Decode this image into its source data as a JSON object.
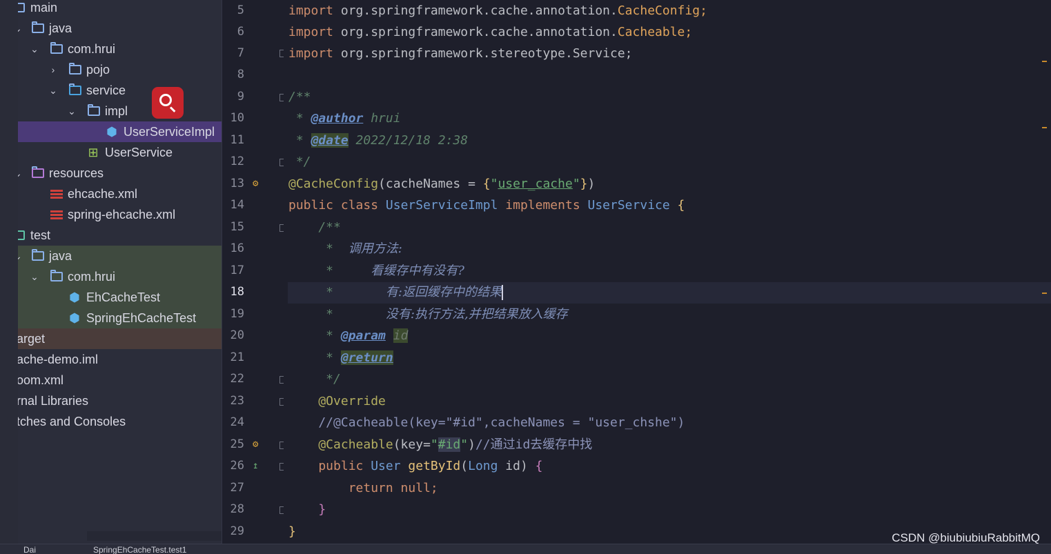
{
  "project_tree": [
    {
      "label": "main",
      "kind": "folder-root"
    },
    {
      "label": "java",
      "kind": "folder"
    },
    {
      "label": "com.hrui",
      "kind": "package"
    },
    {
      "label": "pojo",
      "kind": "package"
    },
    {
      "label": "service",
      "kind": "package"
    },
    {
      "label": "impl",
      "kind": "package"
    },
    {
      "label": "UserServiceImpl",
      "kind": "class",
      "selected": true
    },
    {
      "label": "UserService",
      "kind": "interface"
    },
    {
      "label": "resources",
      "kind": "resources"
    },
    {
      "label": "ehcache.xml",
      "kind": "xml"
    },
    {
      "label": "spring-ehcache.xml",
      "kind": "xml"
    },
    {
      "label": "test",
      "kind": "folder-root"
    },
    {
      "label": "java",
      "kind": "folder"
    },
    {
      "label": "com.hrui",
      "kind": "package"
    },
    {
      "label": "EhCacheTest",
      "kind": "class"
    },
    {
      "label": "SpringEhCacheTest",
      "kind": "class"
    },
    {
      "label": "arget",
      "kind": "excluded"
    },
    {
      "label": "ache-demo.iml",
      "kind": "file"
    },
    {
      "label": "oom.xml",
      "kind": "file"
    },
    {
      "label": "rnal Libraries",
      "kind": "libraries"
    },
    {
      "label": "tches and Consoles",
      "kind": "scratches"
    }
  ],
  "editor": {
    "line_numbers": [
      "5",
      "6",
      "7",
      "8",
      "9",
      "10",
      "11",
      "12",
      "13",
      "14",
      "15",
      "16",
      "17",
      "18",
      "19",
      "20",
      "21",
      "22",
      "23",
      "24",
      "25",
      "26",
      "27",
      "28",
      "29"
    ],
    "current_line": "18",
    "lines": {
      "l5_kw": "import",
      "l5_pkg": " org.springframework.cache.annotation.",
      "l5_cls": "CacheConfig",
      "l5_end": ";",
      "l6_kw": "import",
      "l6_pkg": " org.springframework.cache.annotation.",
      "l6_cls": "Cacheable",
      "l6_end": ";",
      "l7_kw": "import",
      "l7_pkg": " org.springframework.stereotype.Service;",
      "l9": "/**",
      "l10_a": " * ",
      "l10_tag": "@author",
      "l10_b": " hrui",
      "l11_a": " * ",
      "l11_tag": "@date",
      "l11_b": " 2022/12/18 2:38",
      "l12": " */",
      "l13_ann": "@CacheConfig",
      "l13_a": "(cacheNames = ",
      "l13_b1": "{",
      "l13_str1": "\"",
      "l13_str": "user_cache",
      "l13_str2": "\"",
      "l13_b2": "}",
      "l13_c": ")",
      "l14_kw1": "public class ",
      "l14_cls": "UserServiceImpl",
      "l14_kw2": " implements ",
      "l14_cls2": "UserService",
      "l14_b": " {",
      "l15": "    /**",
      "l16_a": "     *  ",
      "l16_zh": "调用方法:",
      "l17_a": "     *     ",
      "l17_zh": "看缓存中有没有?",
      "l18_a": "     *       ",
      "l18_zh": "有:返回缓存中的结果",
      "l19_a": "     *       ",
      "l19_zh": "没有:执行方法,并把结果放入缓存",
      "l20_a": "     * ",
      "l20_tag": "@param",
      "l20_sp": " ",
      "l20_p": "id",
      "l21_a": "     * ",
      "l21_tag": "@return",
      "l22": "     */",
      "l23": "    @Override",
      "l24": "    //@Cacheable(key=\"#id\",cacheNames = \"user_chshe\")",
      "l25_ann": "    @Cacheable",
      "l25_a": "(key=",
      "l25_s1": "\"",
      "l25_s2": "#id",
      "l25_s3": "\"",
      "l25_b": ")",
      "l25_cmt": "//通过id去缓存中找",
      "l26_kw": "    public ",
      "l26_cls": "User ",
      "l26_fn": "getById",
      "l26_a": "(",
      "l26_cls2": "Long",
      "l26_b": " id) ",
      "l26_c": "{",
      "l27_kw": "        return null",
      "l27_b": ";",
      "l28": "    }",
      "l29": "}"
    }
  },
  "status_bar": {
    "left": "Dai",
    "middle": "SpringEhCacheTest.test1"
  },
  "watermark": "CSDN @biubiubiuRabbitMQ",
  "colors": {
    "keyword": "#cf8e6d",
    "annotation": "#b3ae60",
    "class": "#6f9bd1",
    "string": "#6aab73",
    "selection": "#4b3a78",
    "search_badge": "#c8242b"
  }
}
